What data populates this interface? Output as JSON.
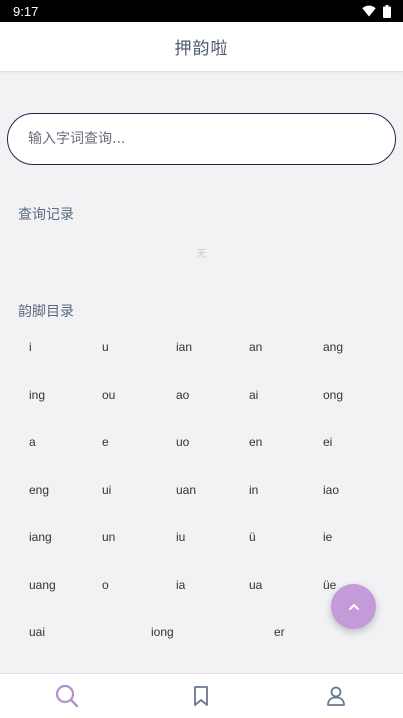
{
  "status_bar": {
    "time": "9:17"
  },
  "app_bar": {
    "title": "押韵啦"
  },
  "search": {
    "placeholder": "输入字词查询..."
  },
  "history": {
    "title": "查询记录",
    "empty_text": "无"
  },
  "rhyme_index": {
    "title": "韵脚目录",
    "rows": [
      [
        "i",
        "u",
        "ian",
        "an",
        "ang"
      ],
      [
        "ing",
        "ou",
        "ao",
        "ai",
        "ong"
      ],
      [
        "a",
        "e",
        "uo",
        "en",
        "ei"
      ],
      [
        "eng",
        "ui",
        "uan",
        "in",
        "iao"
      ],
      [
        "iang",
        "un",
        "iu",
        "ü",
        "ie"
      ],
      [
        "uang",
        "o",
        "ia",
        "ua",
        "üe"
      ],
      [
        "uai",
        "iong",
        "er"
      ]
    ]
  },
  "colors": {
    "accent": "#c39bd9",
    "nav_active": "#b48fce",
    "nav_inactive": "#6a7890",
    "search_border": "#1f2a44"
  },
  "bottom_nav": [
    {
      "icon": "search-icon",
      "active": true
    },
    {
      "icon": "bookmark-icon",
      "active": false
    },
    {
      "icon": "person-icon",
      "active": false
    }
  ]
}
